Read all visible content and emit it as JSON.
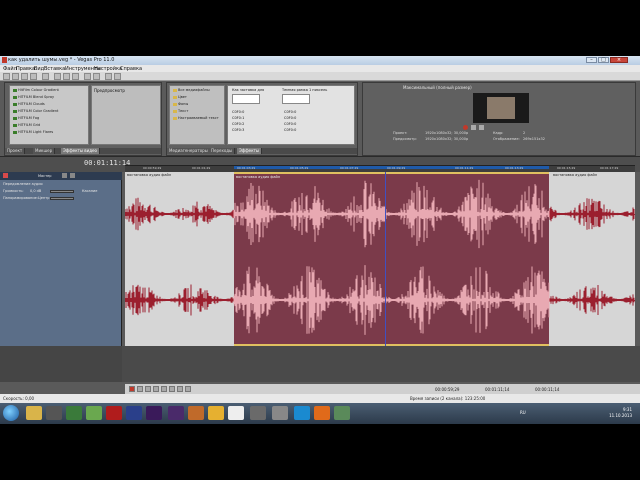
{
  "app": {
    "title": "как удалить шумы.veg * - Vegas Pro 11.0"
  },
  "menu": [
    "Файл",
    "Правка",
    "Вид",
    "Вставка",
    "Инструменты",
    "Настройка",
    "Справка"
  ],
  "effects_panel": {
    "preview_label": "Предпросмотр",
    "items": [
      "HitFilm Colour Gradient",
      "HITFILM Blend Spray",
      "HITFILM Clouds",
      "HITFILM Color Gradient",
      "HITFILM Fog",
      "HITFILM Grid",
      "HITFILM Light Flares"
    ],
    "tabs": [
      "Проект",
      "Микшер",
      "Эффекты видео",
      "Эффекты мультимедиа"
    ]
  },
  "media_panel": {
    "tree": [
      "Все медиафайлы",
      "Цвет",
      "Фоны",
      "Текст",
      "Настраиваемый текст"
    ],
    "gen_items": [
      "Как заставка для",
      "Темная рамка 1 пиксель"
    ],
    "tabs": [
      "Медиагенераторы",
      "Переходы",
      "Эффекты"
    ],
    "colors": [
      "C0F0:0",
      "C0F0:1",
      "C0F0:2",
      "C0F0:3"
    ],
    "values": [
      "C0F0:0",
      "C0F0:0",
      "C0F0:0",
      "C0F0:0"
    ]
  },
  "preview_panel": {
    "mode": "Максимальный (полный размер)",
    "project_label": "Проект:",
    "project_value": "1920x1080x32; 30,000p",
    "preview_label": "Предосмотр:",
    "preview_value": "1920x1080x32; 30,000p",
    "frame_label": "Кадр:",
    "frame_value": "2",
    "display_label": "Отображение:",
    "display_value": "269x151x32"
  },
  "timeline": {
    "timecode": "00:01:11:14",
    "ruler_labels": [
      "00:00:59;29",
      "00:01:01;29",
      "00:01:03;29",
      "00:01:05;29",
      "00:01:07;29",
      "00:01:09;29",
      "00:01:11;29",
      "00:01:13;29",
      "00:01:15;29",
      "00:01:17;29"
    ],
    "clip_name": "востановка аудио файл",
    "track_label": "Мастер",
    "track_name": "Передомление аудио",
    "volume_label": "Громкость:",
    "volume_value": "0,0 dB",
    "pan_label": "Панорамирование:",
    "pan_value": "Центр",
    "touch_label": "Касание"
  },
  "status": {
    "rate": "Скорость: 0,00",
    "position": "00:00:59;29",
    "end": "00:01:11;14",
    "duration": "00:00:11;14",
    "record": "Время записи (2 канала): 123:25:00"
  },
  "taskbar": {
    "lang": "RU",
    "time": "9:31",
    "date": "11.10.2013"
  }
}
